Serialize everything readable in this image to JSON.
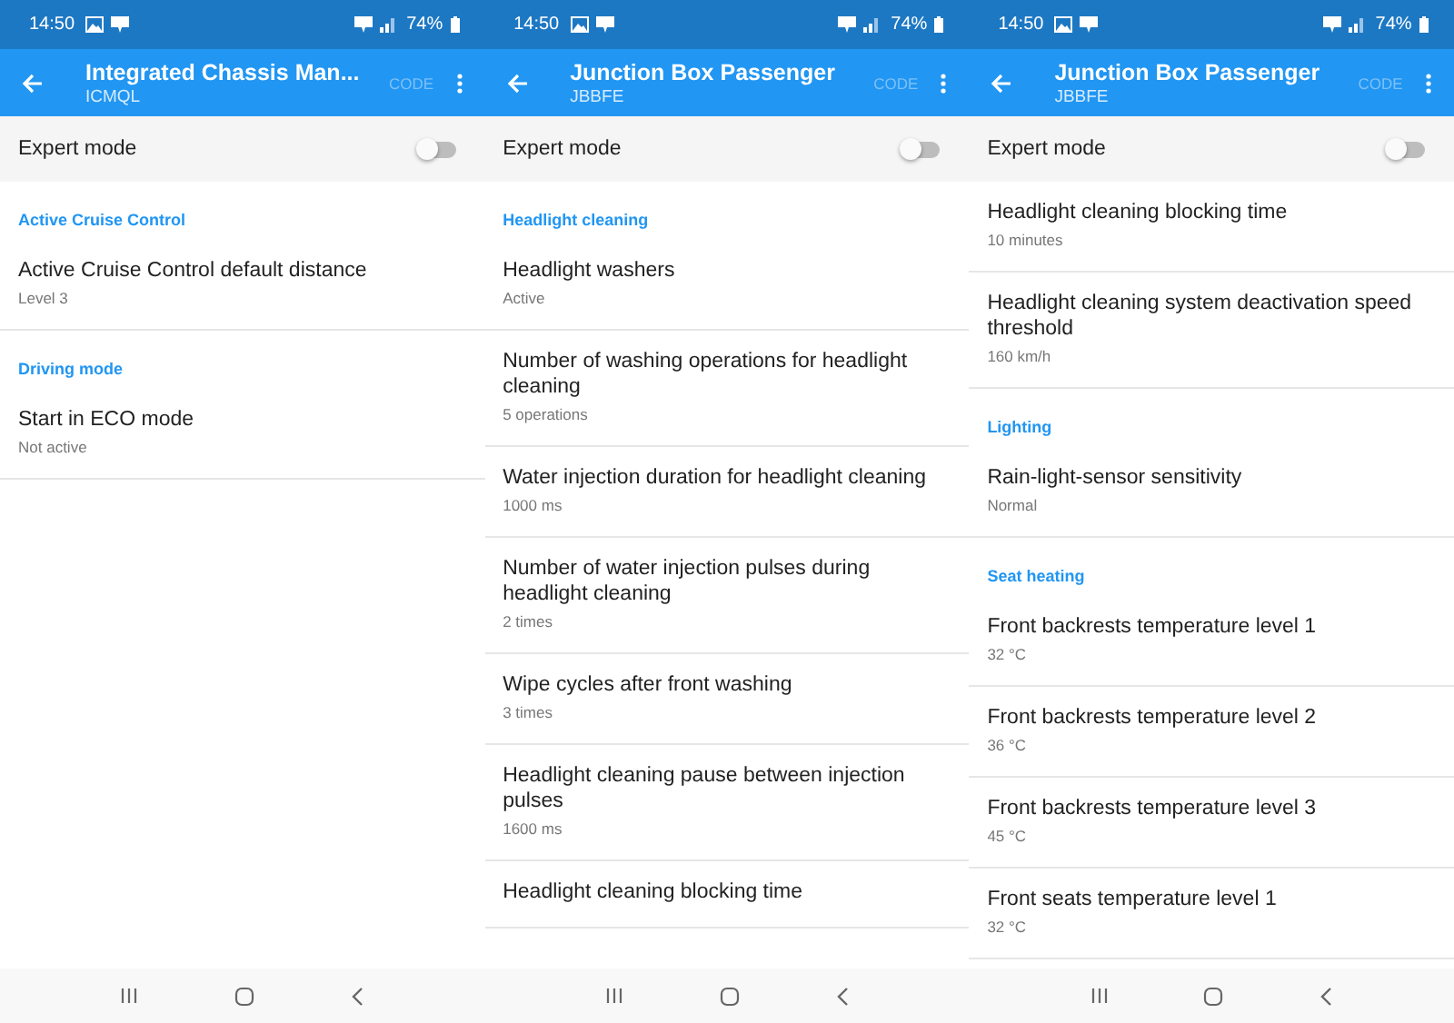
{
  "screens": [
    {
      "status_bar": {
        "time": "14:50",
        "battery": "74%"
      },
      "app_bar": {
        "title": "Integrated Chassis Man...",
        "subtitle": "ICMQL",
        "action": "CODE"
      },
      "expert_mode": {
        "label": "Expert mode",
        "on": false
      },
      "items": [
        {
          "kind": "header",
          "title": "Active Cruise Control"
        },
        {
          "kind": "setting",
          "title": "Active Cruise Control default distance",
          "value": "Level 3"
        },
        {
          "kind": "header",
          "title": "Driving mode"
        },
        {
          "kind": "setting",
          "title": "Start in ECO mode",
          "value": "Not active"
        }
      ]
    },
    {
      "status_bar": {
        "time": "14:50",
        "battery": "74%"
      },
      "app_bar": {
        "title": "Junction Box Passenger",
        "subtitle": "JBBFE",
        "action": "CODE"
      },
      "expert_mode": {
        "label": "Expert mode",
        "on": false
      },
      "items": [
        {
          "kind": "header",
          "title": "Headlight cleaning"
        },
        {
          "kind": "setting",
          "title": "Headlight washers",
          "value": "Active"
        },
        {
          "kind": "setting",
          "title": "Number of washing operations for headlight cleaning",
          "value": "5 operations"
        },
        {
          "kind": "setting",
          "title": "Water injection duration for headlight cleaning",
          "value": "1000 ms"
        },
        {
          "kind": "setting",
          "title": "Number of water injection pulses during headlight cleaning",
          "value": "2 times"
        },
        {
          "kind": "setting",
          "title": "Wipe cycles after front washing",
          "value": "3 times"
        },
        {
          "kind": "setting",
          "title": "Headlight cleaning pause between injection pulses",
          "value": "1600 ms"
        },
        {
          "kind": "setting",
          "title": "Headlight cleaning blocking time"
        }
      ]
    },
    {
      "status_bar": {
        "time": "14:50",
        "battery": "74%"
      },
      "app_bar": {
        "title": "Junction Box Passenger",
        "subtitle": "JBBFE",
        "action": "CODE"
      },
      "expert_mode": {
        "label": "Expert mode",
        "on": false
      },
      "items": [
        {
          "kind": "setting",
          "title": "Headlight cleaning blocking time",
          "value": "10 minutes"
        },
        {
          "kind": "setting",
          "title": "Headlight cleaning system deactivation speed threshold",
          "value": "160 km/h"
        },
        {
          "kind": "header",
          "title": "Lighting"
        },
        {
          "kind": "setting",
          "title": "Rain-light-sensor sensitivity",
          "value": "Normal"
        },
        {
          "kind": "header",
          "title": "Seat heating"
        },
        {
          "kind": "setting",
          "title": "Front backrests temperature level 1",
          "value": "32 °C"
        },
        {
          "kind": "setting",
          "title": "Front backrests temperature level 2",
          "value": "36 °C"
        },
        {
          "kind": "setting",
          "title": "Front backrests temperature level 3",
          "value": "45 °C"
        },
        {
          "kind": "setting",
          "title": "Front seats temperature level 1",
          "value": "32 °C"
        }
      ]
    }
  ]
}
